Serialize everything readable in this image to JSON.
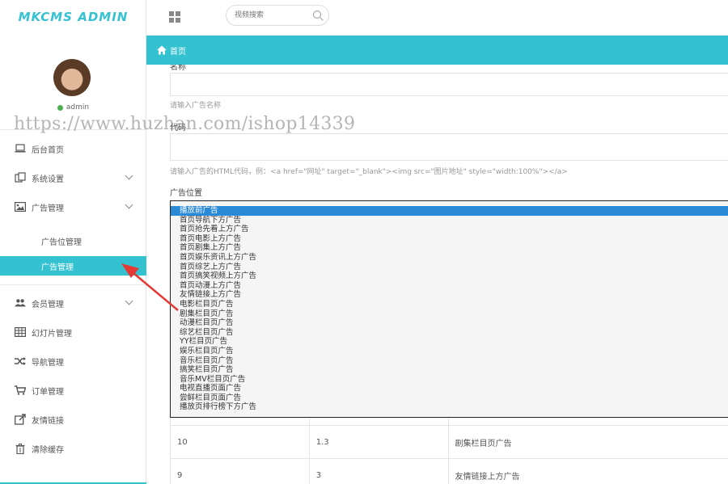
{
  "app": {
    "logo_text": "MKCMS ADMIN"
  },
  "user": {
    "name": "admin",
    "status_color": "#4caf50"
  },
  "search": {
    "placeholder": "视频搜索"
  },
  "breadcrumb": {
    "home_label": "首页"
  },
  "sidebar": {
    "items": [
      {
        "label": "后台首页",
        "icon": "laptop-icon"
      },
      {
        "label": "系统设置",
        "icon": "settings-icon",
        "expandable": true
      },
      {
        "label": "广告管理",
        "icon": "image-icon",
        "expandable": true
      },
      {
        "label": "会员管理",
        "icon": "users-icon",
        "expandable": true
      },
      {
        "label": "幻灯片管理",
        "icon": "table-icon"
      },
      {
        "label": "导航管理",
        "icon": "shuffle-icon"
      },
      {
        "label": "订单管理",
        "icon": "cart-icon"
      },
      {
        "label": "友情链接",
        "icon": "external-link-icon"
      },
      {
        "label": "清除缓存",
        "icon": "trash-icon"
      }
    ],
    "subitems": [
      {
        "label": "广告位管理",
        "active": false
      },
      {
        "label": "广告管理",
        "active": true
      }
    ]
  },
  "form": {
    "name_label": "名称",
    "name_hint": "请输入广告名称",
    "code_label": "代码",
    "code_hint": "请输入广告的HTML代码，例：<a href=\"网址\" target=\"_blank\"><img src=\"图片地址\" style=\"width:100%\"></a>",
    "position_label": "广告位置",
    "position_options": [
      "播放前广告",
      "首页导航下方广告",
      "首页抢先看上方广告",
      "首页电影上方广告",
      "首页剧集上方广告",
      "首页娱乐资讯上方广告",
      "首页综艺上方广告",
      "首页搞笑视频上方广告",
      "首页动漫上方广告",
      "友情链接上方广告",
      "电影栏目页广告",
      "剧集栏目页广告",
      "动漫栏目页广告",
      "综艺栏目页广告",
      "YY栏目页广告",
      "娱乐栏目页广告",
      "音乐栏目页广告",
      "搞笑栏目页广告",
      "音乐MV栏目页广告",
      "电视直播页面广告",
      "尝鲜栏目页面广告",
      "播放页排行榜下方广告"
    ],
    "position_selected_index": 0
  },
  "table": {
    "rows": [
      [
        "10",
        "1.3",
        "剧集栏目页广告"
      ],
      [
        "9",
        "3",
        "友情链接上方广告"
      ]
    ]
  },
  "watermark": "https://www.huzhan.com/ishop14339",
  "colors": {
    "accent": "#35c2d0",
    "selected": "#2a8ad8",
    "arrow": "#e53935"
  }
}
